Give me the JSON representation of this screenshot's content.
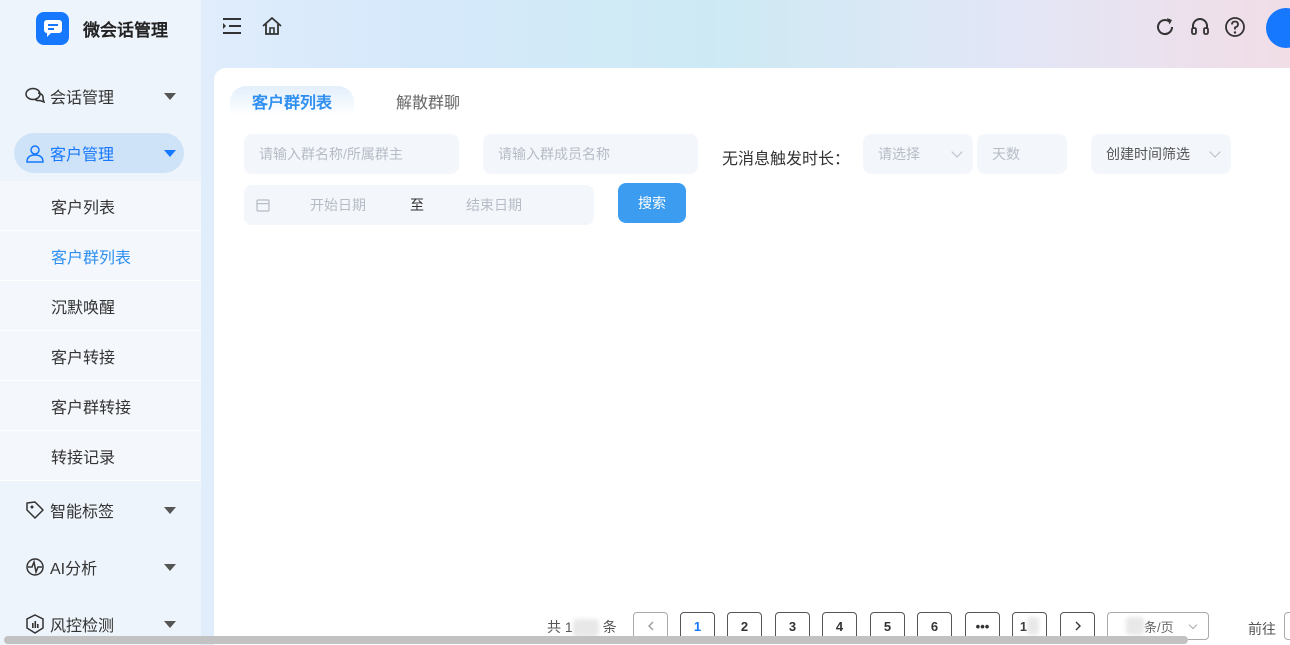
{
  "app": {
    "title": "微会话管理"
  },
  "sidebar": {
    "menus": [
      {
        "label": "会话管理",
        "icon": "chat-icon"
      },
      {
        "label": "客户管理",
        "icon": "user-icon"
      },
      {
        "label": "智能标签",
        "icon": "tag-icon"
      },
      {
        "label": "AI分析",
        "icon": "ai-analysis-icon"
      },
      {
        "label": "风控检测",
        "icon": "shield-icon"
      }
    ],
    "submenu": [
      "客户列表",
      "客户群列表",
      "沉默唤醒",
      "客户转接",
      "客户群转接",
      "转接记录"
    ]
  },
  "tabs": [
    "客户群列表",
    "解散群聊"
  ],
  "filters": {
    "group_name_placeholder": "请输入群名称/所属群主",
    "member_name_placeholder": "请输入群成员名称",
    "no_msg_label": "无消息触发时长：",
    "select_placeholder": "请选择",
    "days_placeholder": "天数",
    "create_time_filter": "创建时间筛选",
    "start_date": "开始日期",
    "date_sep": "至",
    "end_date": "结束日期",
    "search_button": "搜索"
  },
  "pagination": {
    "total_prefix": "共 1",
    "total_suffix": "条",
    "pages": [
      "1",
      "2",
      "3",
      "4",
      "5",
      "6",
      "•••",
      "1"
    ],
    "per_page_suffix": "条/页",
    "goto_label": "前往",
    "current_page": 1
  },
  "colors": {
    "accent": "#1677ff",
    "link": "#2e8ff0",
    "search_button": "#3b9cf0"
  }
}
